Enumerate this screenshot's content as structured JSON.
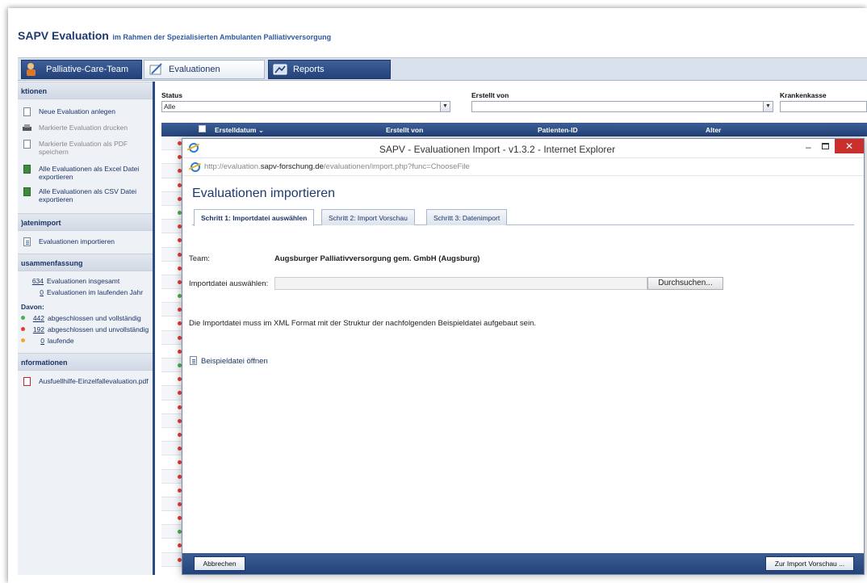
{
  "header": {
    "title": "SAPV Evaluation",
    "subtitle": "im Rahmen der Spezialisierten Ambulanten Palliativversorgung"
  },
  "main_tabs": [
    {
      "label": "Palliative-Care-Team",
      "icon": "team-icon"
    },
    {
      "label": "Evaluationen",
      "icon": "evaluation-icon"
    },
    {
      "label": "Reports",
      "icon": "reports-icon"
    }
  ],
  "sidebar": {
    "actions_title": "ktionen",
    "actions": [
      {
        "label": "Neue Evaluation anlegen",
        "icon": "new-document-icon",
        "enabled": true
      },
      {
        "label": "Markierte Evaluation drucken",
        "icon": "print-icon",
        "enabled": false
      },
      {
        "label": "Markierte Evaluation als PDF speichern",
        "icon": "pdf-icon",
        "enabled": false
      },
      {
        "label": "Alle Evaluationen als Excel Datei exportieren",
        "icon": "excel-icon",
        "enabled": true
      },
      {
        "label": "Alle Evaluationen als CSV Datei exportieren",
        "icon": "csv-icon",
        "enabled": true
      }
    ],
    "import_title": ")atenimport",
    "import_item": "Evaluationen importieren",
    "summary_title": "usammenfassung",
    "summary_total_num": "634",
    "summary_total_label": "Evaluationen insgesamt",
    "summary_year_num": "0",
    "summary_year_label": "Evaluationen im laufenden Jahr",
    "davon_label": "Davon:",
    "davon": [
      {
        "num": "442",
        "label": "abgeschlossen und vollständig",
        "color": "#4caf50"
      },
      {
        "num": "192",
        "label": "abgeschlossen und unvollständig",
        "color": "#e53935"
      },
      {
        "num": "0",
        "label": "laufende",
        "color": "#f5a623"
      }
    ],
    "info_title": "nformationen",
    "info_item": "Ausfuellhilfe-Einzelfallevaluation.pdf"
  },
  "filters": {
    "status_label": "Status",
    "status_value": "Alle",
    "created_by_label": "Erstellt von",
    "created_by_value": "",
    "insurance_label": "Krankenkasse"
  },
  "grid": {
    "columns": [
      "Erstelldatum ⌄",
      "Erstellt von",
      "Patienten-ID",
      "Alter"
    ],
    "row_status_colors": [
      "#e53935",
      "#e53935",
      "#e53935",
      "#e53935",
      "#e53935",
      "#4caf50",
      "#e53935",
      "#e53935",
      "#e53935",
      "#e53935",
      "#e53935",
      "#4caf50",
      "#e53935",
      "#e53935",
      "#e53935",
      "#e53935",
      "#4caf50",
      "#e53935",
      "#e53935",
      "#e53935",
      "#e53935",
      "#e53935",
      "#e53935",
      "#e53935",
      "#e53935",
      "#e53935",
      "#e53935",
      "#e53935",
      "#4caf50",
      "#e53935",
      "#e53935"
    ]
  },
  "popup": {
    "window_title": "SAPV - Evaluationen Import - v1.3.2 - Internet Explorer",
    "url_prefix": "http://evaluation.",
    "url_domain": "sapv-forschung.de",
    "url_path": "/evaluationen/import.php?func=ChooseFile",
    "heading": "Evaluationen importieren",
    "steps": [
      "Schritt 1: Importdatei auswählen",
      "Schritt 2: Import Vorschau",
      "Schritt 3: Datenimport"
    ],
    "team_label": "Team:",
    "team_value": "Augsburger Palliativversorgung gem. GmbH (Augsburg)",
    "file_label": "Importdatei auswählen:",
    "file_value": "",
    "browse_label": "Durchsuchen...",
    "hint": "Die Importdatei muss im XML Format mit der Struktur der nachfolgenden Beispieldatei aufgebaut sein.",
    "example_link": "Beispieldatei öffnen",
    "cancel_label": "Abbrechen",
    "next_label": "Zur Import Vorschau ..."
  }
}
